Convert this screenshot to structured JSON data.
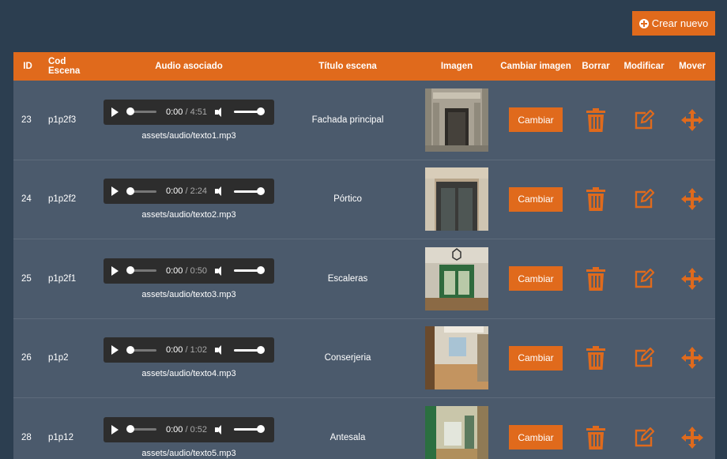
{
  "toolbar": {
    "create_label": "Crear nuevo",
    "create_icon": "plus-circle-icon"
  },
  "colors": {
    "accent": "#e06a1c",
    "background": "#2c3e50",
    "table_bg": "#4b5a6c"
  },
  "table": {
    "headers": {
      "id": "ID",
      "cod": "Cod Escena",
      "audio": "Audio asociado",
      "title": "Título escena",
      "image": "Imagen",
      "change": "Cambiar imagen",
      "delete": "Borrar",
      "modify": "Modificar",
      "move": "Mover"
    },
    "rows": [
      {
        "id": "23",
        "cod": "p1p2f3",
        "time": "0:00",
        "duration": "4:51",
        "path": "assets/audio/texto1.mp3",
        "title": "Fachada principal",
        "change_label": "Cambiar"
      },
      {
        "id": "24",
        "cod": "p1p2f2",
        "time": "0:00",
        "duration": "2:24",
        "path": "assets/audio/texto2.mp3",
        "title": "Pórtico",
        "change_label": "Cambiar"
      },
      {
        "id": "25",
        "cod": "p1p2f1",
        "time": "0:00",
        "duration": "0:50",
        "path": "assets/audio/texto3.mp3",
        "title": "Escaleras",
        "change_label": "Cambiar"
      },
      {
        "id": "26",
        "cod": "p1p2",
        "time": "0:00",
        "duration": "1:02",
        "path": "assets/audio/texto4.mp3",
        "title": "Conserjeria",
        "change_label": "Cambiar"
      },
      {
        "id": "28",
        "cod": "p1p12",
        "time": "0:00",
        "duration": "0:52",
        "path": "assets/audio/texto5.mp3",
        "title": "Antesala",
        "change_label": "Cambiar"
      }
    ],
    "icons": {
      "delete": "trash-icon",
      "modify": "edit-icon",
      "move": "move-arrows-icon"
    }
  }
}
